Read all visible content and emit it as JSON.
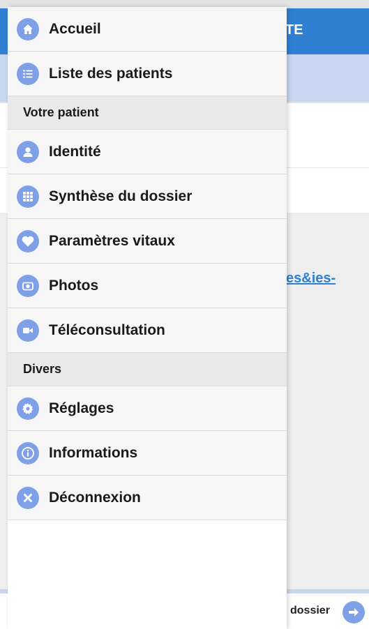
{
  "background": {
    "header_fragment": "TE",
    "link_fragment": "es&ies-",
    "footer_label": "dossier"
  },
  "drawer": {
    "top_items": [
      {
        "label": "Accueil",
        "icon": "home-icon"
      },
      {
        "label": "Liste des patients",
        "icon": "list-icon"
      }
    ],
    "section_patient": "Votre patient",
    "patient_items": [
      {
        "label": "Identité",
        "icon": "person-icon"
      },
      {
        "label": "Synthèse du dossier",
        "icon": "grid-icon"
      },
      {
        "label": "Paramètres vitaux",
        "icon": "heart-icon"
      },
      {
        "label": "Photos",
        "icon": "camera-icon"
      },
      {
        "label": "Téléconsultation",
        "icon": "video-icon"
      }
    ],
    "section_misc": "Divers",
    "misc_items": [
      {
        "label": "Réglages",
        "icon": "gear-icon"
      },
      {
        "label": "Informations",
        "icon": "info-icon"
      },
      {
        "label": "Déconnexion",
        "icon": "close-icon"
      }
    ]
  },
  "colors": {
    "accent": "#2f7fd3",
    "icon_bg": "#7f9fe6"
  }
}
